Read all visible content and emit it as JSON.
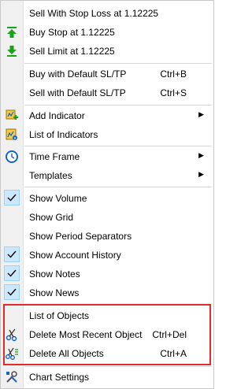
{
  "menu": {
    "items": [
      {
        "label": "Sell With Stop Loss at 1.12225"
      },
      {
        "label": "Buy Stop at 1.12225",
        "icon": "green-up-arrow-icon"
      },
      {
        "label": "Sell Limit at 1.12225",
        "icon": "green-down-arrow-icon"
      },
      {
        "label": "Buy with Default SL/TP",
        "shortcut": "Ctrl+B"
      },
      {
        "label": "Sell with Default SL/TP",
        "shortcut": "Ctrl+S"
      },
      {
        "label": "Add Indicator",
        "icon": "add-indicator-icon",
        "submenu": true
      },
      {
        "label": "List of Indicators",
        "icon": "list-of-indicators-icon"
      },
      {
        "label": "Time Frame",
        "icon": "clock-icon",
        "submenu": true
      },
      {
        "label": "Templates",
        "submenu": true
      },
      {
        "label": "Show Volume",
        "checked": true
      },
      {
        "label": "Show Grid"
      },
      {
        "label": "Show Period Separators"
      },
      {
        "label": "Show Account History",
        "checked": true
      },
      {
        "label": "Show Notes",
        "checked": true
      },
      {
        "label": "Show News",
        "checked": true
      },
      {
        "label": "List of Objects"
      },
      {
        "label": "Delete Most Recent Object",
        "shortcut": "Ctrl+Del",
        "icon": "scissors-icon"
      },
      {
        "label": "Delete All Objects",
        "shortcut": "Ctrl+A",
        "icon": "scissors-all-icon"
      },
      {
        "label": "Chart Settings",
        "icon": "settings-tools-icon"
      }
    ]
  },
  "colors": {
    "highlight_border": "#e32a2a",
    "check_bg": "#cce8ff",
    "icon_green": "#1aa11a",
    "icon_blue": "#1565c0",
    "gutter": "#f0f0f0"
  }
}
